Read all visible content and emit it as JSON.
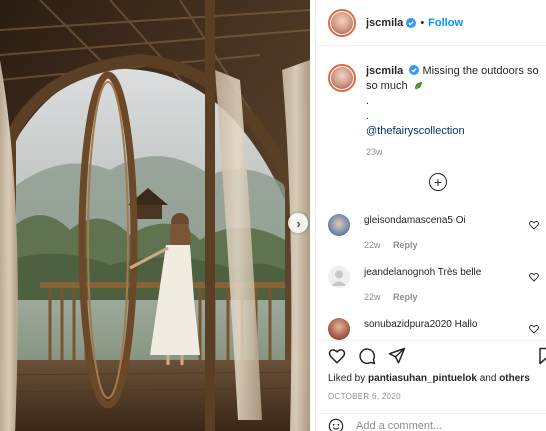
{
  "post": {
    "username": "jscmila",
    "follow_label": "Follow",
    "dot": "•",
    "caption_text": "Missing the outdoors so so much",
    "caption_dot1": ".",
    "caption_dot2": ".",
    "mention": "@thefairyscollection",
    "time": "23w",
    "likes_prefix": "Liked by",
    "likes_user": "pantiasuhan_pintuelok",
    "likes_and": "and",
    "likes_others": "others",
    "date": "OCTOBER 6, 2020",
    "add_comment_placeholder": "Add a comment..."
  },
  "comments": [
    {
      "username": "gleisondamascena5",
      "text": "Oi",
      "time": "22w",
      "reply": "Reply"
    },
    {
      "username": "jeandelanognoh",
      "text": "Très belle",
      "time": "22w",
      "reply": "Reply"
    },
    {
      "username": "sonubazidpura2020",
      "text": "Hallo",
      "time": "",
      "reply": ""
    }
  ],
  "icons": {
    "verified": "verified-badge-icon",
    "like": "heart-icon",
    "comment": "comment-icon",
    "share": "share-icon",
    "save": "bookmark-icon",
    "emoji": "emoji-icon",
    "load_more": "plus-circle-icon",
    "next": "chevron-right-icon"
  },
  "colors": {
    "accent": "#0095f6",
    "muted": "#8e8e8e",
    "text": "#262626",
    "mention": "#00376b"
  }
}
